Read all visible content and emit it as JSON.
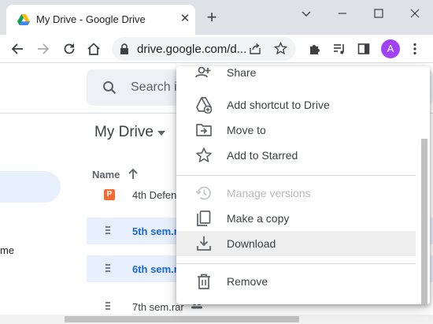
{
  "browser": {
    "tab_title": "My Drive - Google Drive",
    "url": "drive.google.com/d...",
    "avatar_letter": "A"
  },
  "drive": {
    "search_placeholder": "Search i",
    "page_title": "My Drive",
    "sidebar_partial_text": "me",
    "column_name": "Name",
    "files": [
      {
        "name": "4th Defen",
        "type": "slides",
        "selected": false
      },
      {
        "name": "5th sem.r",
        "type": "rar",
        "selected": true
      },
      {
        "name": "6th sem.r",
        "type": "rar",
        "selected": true
      },
      {
        "name": "7th sem.rar",
        "type": "rar",
        "selected": false
      }
    ]
  },
  "context_menu": {
    "items": [
      {
        "label": "Share",
        "icon": "add-person-icon",
        "disabled": false
      },
      {
        "label": "Add shortcut to Drive",
        "icon": "shortcut-drive-icon",
        "disabled": false
      },
      {
        "label": "Move to",
        "icon": "move-folder-icon",
        "disabled": false
      },
      {
        "label": "Add to Starred",
        "icon": "star-icon",
        "disabled": false
      },
      {
        "label": "Manage versions",
        "icon": "history-icon",
        "disabled": true
      },
      {
        "label": "Make a copy",
        "icon": "copy-icon",
        "disabled": false
      },
      {
        "label": "Download",
        "icon": "download-icon",
        "disabled": false,
        "hovered": true
      },
      {
        "label": "Remove",
        "icon": "trash-icon",
        "disabled": false
      }
    ]
  },
  "colors": {
    "accent": "#1967d2",
    "selection": "#e8f0fe",
    "avatar": "#a142f4",
    "hover": "#eeeeee"
  }
}
